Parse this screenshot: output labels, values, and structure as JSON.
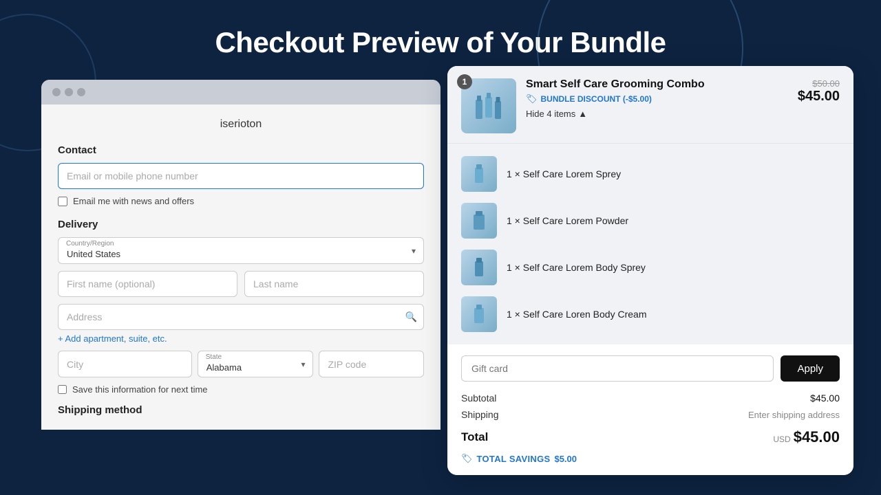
{
  "page": {
    "title": "Checkout Preview of Your Bundle",
    "bg_color": "#0d2340"
  },
  "browser": {
    "store_name": "iserioton"
  },
  "contact": {
    "section_label": "Contact",
    "email_placeholder": "Email or mobile phone number",
    "newsletter_label": "Email me with news and offers"
  },
  "delivery": {
    "section_label": "Delivery",
    "country_label": "Country/Region",
    "country_value": "United States",
    "first_name_placeholder": "First name (optional)",
    "last_name_placeholder": "Last name",
    "address_placeholder": "Address",
    "add_apt_label": "+ Add apartment, suite, etc.",
    "city_placeholder": "City",
    "state_label": "State",
    "state_value": "Alabama",
    "zip_placeholder": "ZIP code",
    "save_label": "Save this information for next time",
    "shipping_method_label": "Shipping method"
  },
  "bundle": {
    "badge_count": "1",
    "name": "Smart Self Care Grooming Combo",
    "discount_label": "BUNDLE DISCOUNT (-$5.00)",
    "hide_items_label": "Hide 4 items",
    "original_price": "$50.00",
    "final_price": "$45.00",
    "items": [
      {
        "name": "1 × Self Care Lorem Sprey",
        "id": "item-1"
      },
      {
        "name": "1 × Self Care Lorem Powder",
        "id": "item-2"
      },
      {
        "name": "1 × Self Care Lorem Body Sprey",
        "id": "item-3"
      },
      {
        "name": "1 × Self Care Loren Body Cream",
        "id": "item-4"
      }
    ]
  },
  "order_summary": {
    "gift_card_placeholder": "Gift card",
    "apply_button_label": "Apply",
    "subtotal_label": "Subtotal",
    "subtotal_value": "$45.00",
    "shipping_label": "Shipping",
    "shipping_value": "Enter shipping address",
    "total_label": "Total",
    "total_currency": "USD",
    "total_value": "$45.00",
    "savings_label": "TOTAL SAVINGS",
    "savings_value": "$5.00"
  }
}
